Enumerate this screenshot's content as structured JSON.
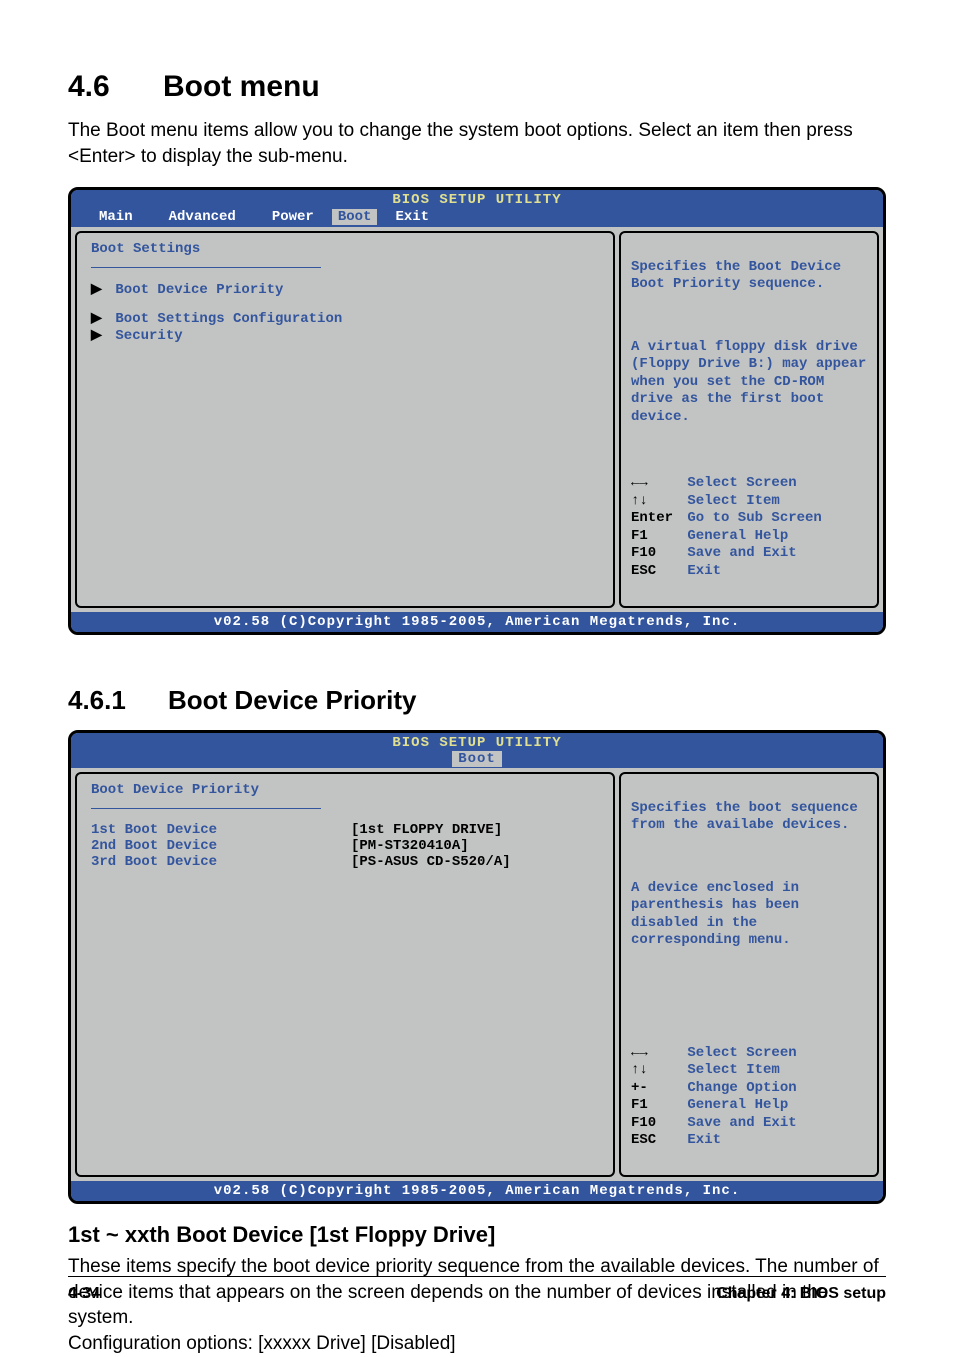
{
  "section": {
    "number": "4.6",
    "title": "Boot menu"
  },
  "intro": "The Boot menu items allow you to change the system boot options. Select an item then press <Enter> to display the sub-menu.",
  "bios1": {
    "header": "BIOS SETUP UTILITY",
    "tabs": [
      "Main",
      "Advanced",
      "Power",
      "Boot",
      "Exit"
    ],
    "activeTab": "Boot",
    "mainTitle": "Boot Settings",
    "items": [
      "Boot Device Priority",
      "Boot Settings Configuration",
      "Security"
    ],
    "help1": "Specifies the Boot Device Boot Priority sequence.",
    "help2": "A virtual floppy disk drive (Floppy Drive B:) may appear when you set the CD-ROM drive as the first boot device.",
    "keys": [
      {
        "sym": "←→",
        "label": "Select Screen"
      },
      {
        "sym": "↑↓",
        "label": "Select Item"
      },
      {
        "sym": "Enter",
        "label": "Go to Sub Screen"
      },
      {
        "sym": "F1",
        "label": "General Help"
      },
      {
        "sym": "F10",
        "label": "Save and Exit"
      },
      {
        "sym": "ESC",
        "label": "Exit"
      }
    ],
    "footer": "v02.58 (C)Copyright 1985-2005, American Megatrends, Inc."
  },
  "subsection": {
    "number": "4.6.1",
    "title": "Boot Device Priority"
  },
  "bios2": {
    "header": "BIOS SETUP UTILITY",
    "activeTabOnly": "Boot",
    "mainTitle": "Boot Device Priority",
    "rows": [
      {
        "label": "1st Boot Device",
        "value": "[1st FLOPPY DRIVE]"
      },
      {
        "label": "2nd Boot Device",
        "value": "[PM-ST320410A]"
      },
      {
        "label": "3rd Boot Device",
        "value": "[PS-ASUS CD-S520/A]"
      }
    ],
    "help1": "Specifies the boot sequence from the availabe devices.",
    "help2": "A device enclosed in parenthesis has been disabled in the corresponding menu.",
    "keys": [
      {
        "sym": "←→",
        "label": "Select Screen"
      },
      {
        "sym": "↑↓",
        "label": "Select Item"
      },
      {
        "sym": "+-",
        "label": "Change Option"
      },
      {
        "sym": "F1",
        "label": "General Help"
      },
      {
        "sym": "F10",
        "label": "Save and Exit"
      },
      {
        "sym": "ESC",
        "label": "Exit"
      }
    ],
    "footer": "v02.58 (C)Copyright 1985-2005, American Megatrends, Inc."
  },
  "item": {
    "title": "1st ~ xxth Boot Device [1st Floppy Drive]",
    "body": "These items specify the boot device priority sequence from the available devices. The number of device items that appears on the screen depends on the number of devices installed in the system.",
    "config": "Configuration options: [xxxxx Drive] [Disabled]"
  },
  "footer": {
    "left": "4-34",
    "right": "Chapter 4: BIOS setup"
  }
}
